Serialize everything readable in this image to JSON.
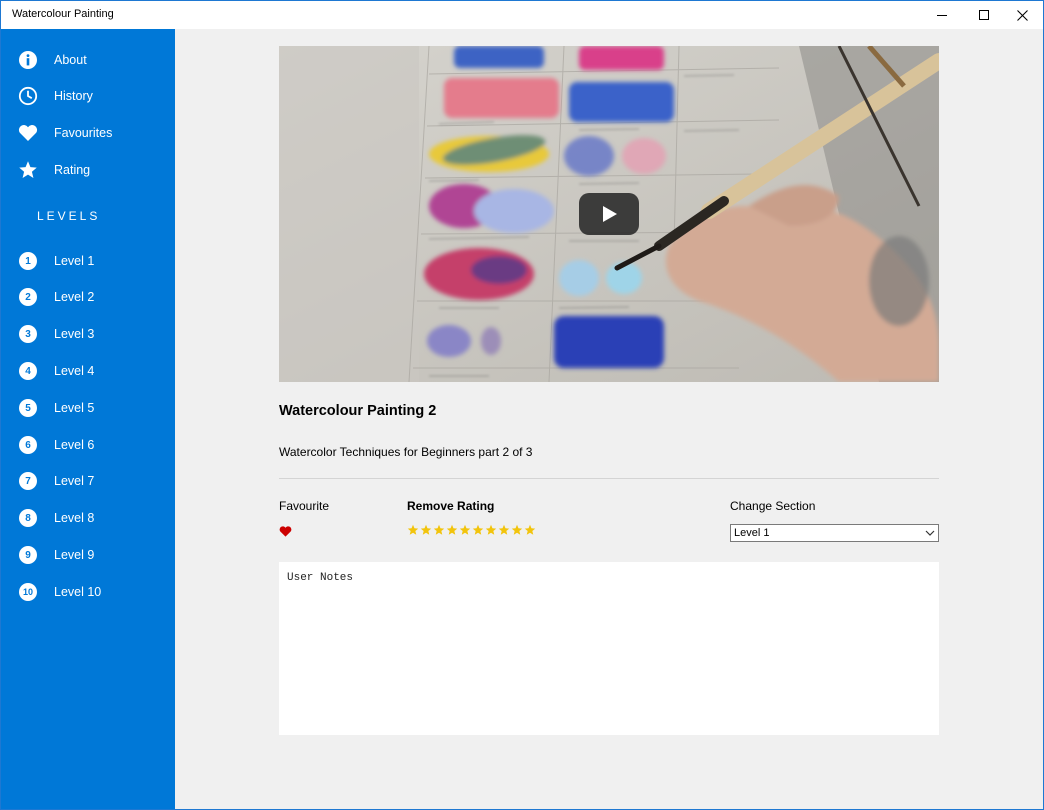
{
  "window": {
    "title": "Watercolour Painting"
  },
  "sidebar": {
    "items": [
      {
        "label": "About",
        "icon": "info-icon"
      },
      {
        "label": "History",
        "icon": "clock-icon"
      },
      {
        "label": "Favourites",
        "icon": "heart-icon"
      },
      {
        "label": "Rating",
        "icon": "star-icon"
      }
    ],
    "levels_header": "LEVELS",
    "levels": [
      {
        "num": "1",
        "label": "Level 1"
      },
      {
        "num": "2",
        "label": "Level 2"
      },
      {
        "num": "3",
        "label": "Level 3"
      },
      {
        "num": "4",
        "label": "Level 4"
      },
      {
        "num": "5",
        "label": "Level 5"
      },
      {
        "num": "6",
        "label": "Level 6"
      },
      {
        "num": "7",
        "label": "Level 7"
      },
      {
        "num": "8",
        "label": "Level 8"
      },
      {
        "num": "9",
        "label": "Level 9"
      },
      {
        "num": "10",
        "label": "Level 10"
      }
    ]
  },
  "video": {
    "title": "Watercolour Painting 2",
    "description": "Watercolor Techniques for Beginners part 2 of 3"
  },
  "details": {
    "favourite_label": "Favourite",
    "rating_label": "Remove Rating",
    "rating_value": 10,
    "rating_max": 10,
    "section_label": "Change Section",
    "section_selected": "Level 1"
  },
  "notes": {
    "placeholder": "User Notes"
  },
  "colors": {
    "sidebar": "#0078d7",
    "heart": "#cc0000",
    "star": "#f2c40c"
  }
}
